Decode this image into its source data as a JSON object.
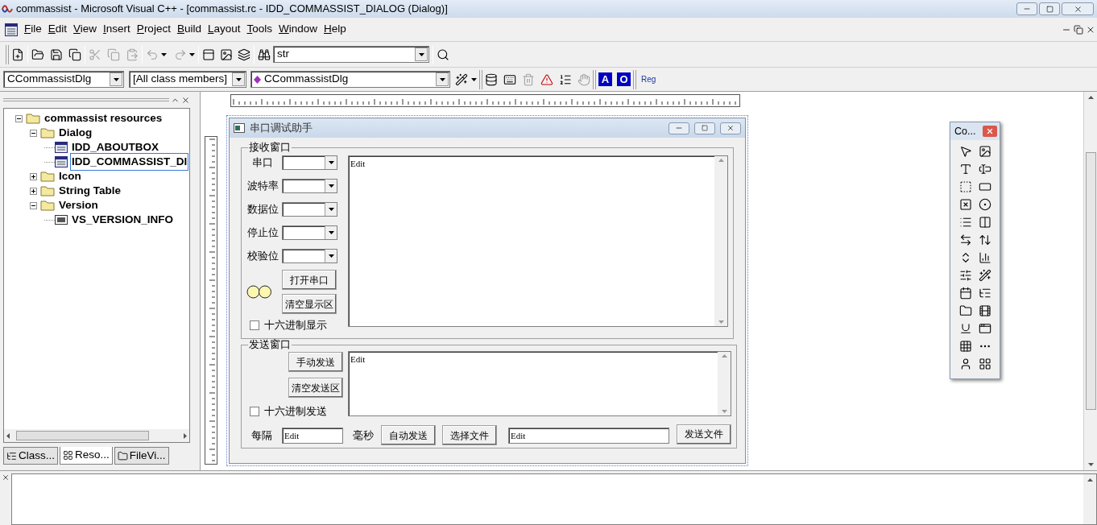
{
  "window": {
    "title": "commassist - Microsoft Visual C++ - [commassist.rc - IDD_COMMASSIST_DIALOG (Dialog)]"
  },
  "menu": [
    {
      "label": "File"
    },
    {
      "label": "Edit"
    },
    {
      "label": "View"
    },
    {
      "label": "Insert"
    },
    {
      "label": "Project"
    },
    {
      "label": "Build"
    },
    {
      "label": "Layout"
    },
    {
      "label": "Tools"
    },
    {
      "label": "Window"
    },
    {
      "label": "Help"
    }
  ],
  "toolbar": {
    "find_value": "str"
  },
  "wizardbar": {
    "class_combo": "CCommassistDlg",
    "filter_combo": "[All class members]",
    "member_combo": "CCommassistDlg",
    "badges": [
      "A",
      "O"
    ],
    "reg": "Reg"
  },
  "tree": [
    {
      "label": "commassist resources",
      "kind": "folder",
      "expanded": true,
      "selected": false,
      "children": [
        {
          "label": "Dialog",
          "kind": "folder",
          "expanded": true,
          "selected": false,
          "children": [
            {
              "label": "IDD_ABOUTBOX",
              "kind": "dialog",
              "selected": false
            },
            {
              "label": "IDD_COMMASSIST_DI",
              "kind": "dialog",
              "selected": true
            }
          ]
        },
        {
          "label": "Icon",
          "kind": "folder",
          "expanded": false,
          "selected": false
        },
        {
          "label": "String Table",
          "kind": "folder",
          "expanded": false,
          "selected": false
        },
        {
          "label": "Version",
          "kind": "folder",
          "expanded": true,
          "selected": false,
          "children": [
            {
              "label": "VS_VERSION_INFO",
              "kind": "version",
              "selected": false
            }
          ]
        }
      ]
    }
  ],
  "panel_tabs": [
    {
      "label": "Class...",
      "selected": false
    },
    {
      "label": "Reso...",
      "selected": true
    },
    {
      "label": "FileVi...",
      "selected": false
    }
  ],
  "dialog": {
    "title": "串口调试助手",
    "receive": {
      "label": "接收窗口",
      "settings": [
        {
          "label": "串口"
        },
        {
          "label": "波特率"
        },
        {
          "label": "数据位"
        },
        {
          "label": "停止位"
        },
        {
          "label": "校验位"
        }
      ],
      "buttons": [
        "打开串口",
        "清空显示区"
      ],
      "hex": {
        "label": "十六进制显示",
        "checked": false
      },
      "edit": "Edit"
    },
    "send": {
      "label": "发送窗口",
      "buttons": [
        "手动发送",
        "清空发送区"
      ],
      "hex": {
        "label": "十六进制发送",
        "checked": false
      },
      "edit": "Edit",
      "interval_label": "每隔",
      "interval_edit": "Edit",
      "unit_label": "毫秒",
      "auto_button": "自动发送",
      "choose_button": "选择文件",
      "file_edit": "Edit",
      "send_file_button": "发送文件"
    }
  },
  "palette": {
    "title": "Co..."
  }
}
